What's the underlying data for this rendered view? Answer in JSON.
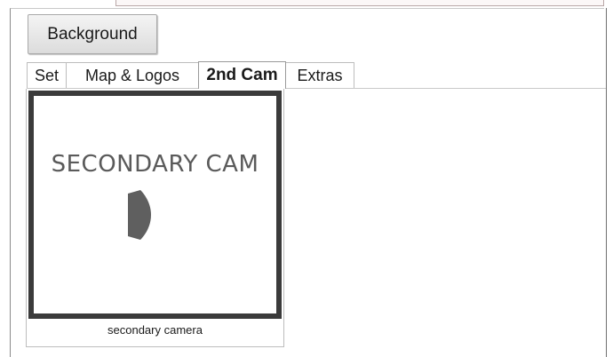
{
  "toolbar": {
    "background_label": "Background"
  },
  "tabs": [
    {
      "label": "Set"
    },
    {
      "label": "Map & Logos"
    },
    {
      "label": "2nd Cam"
    },
    {
      "label": "Extras"
    }
  ],
  "active_tab": "2nd Cam",
  "camera_card": {
    "thumbnail_text": "SECONDARY CAM",
    "caption": "secondary camera",
    "icon": "camera-play-icon"
  },
  "colors": {
    "thumbnail_border": "#3b3b3b",
    "thumbnail_text": "#5a5a5a",
    "icon_fill": "#5f5f5f"
  }
}
